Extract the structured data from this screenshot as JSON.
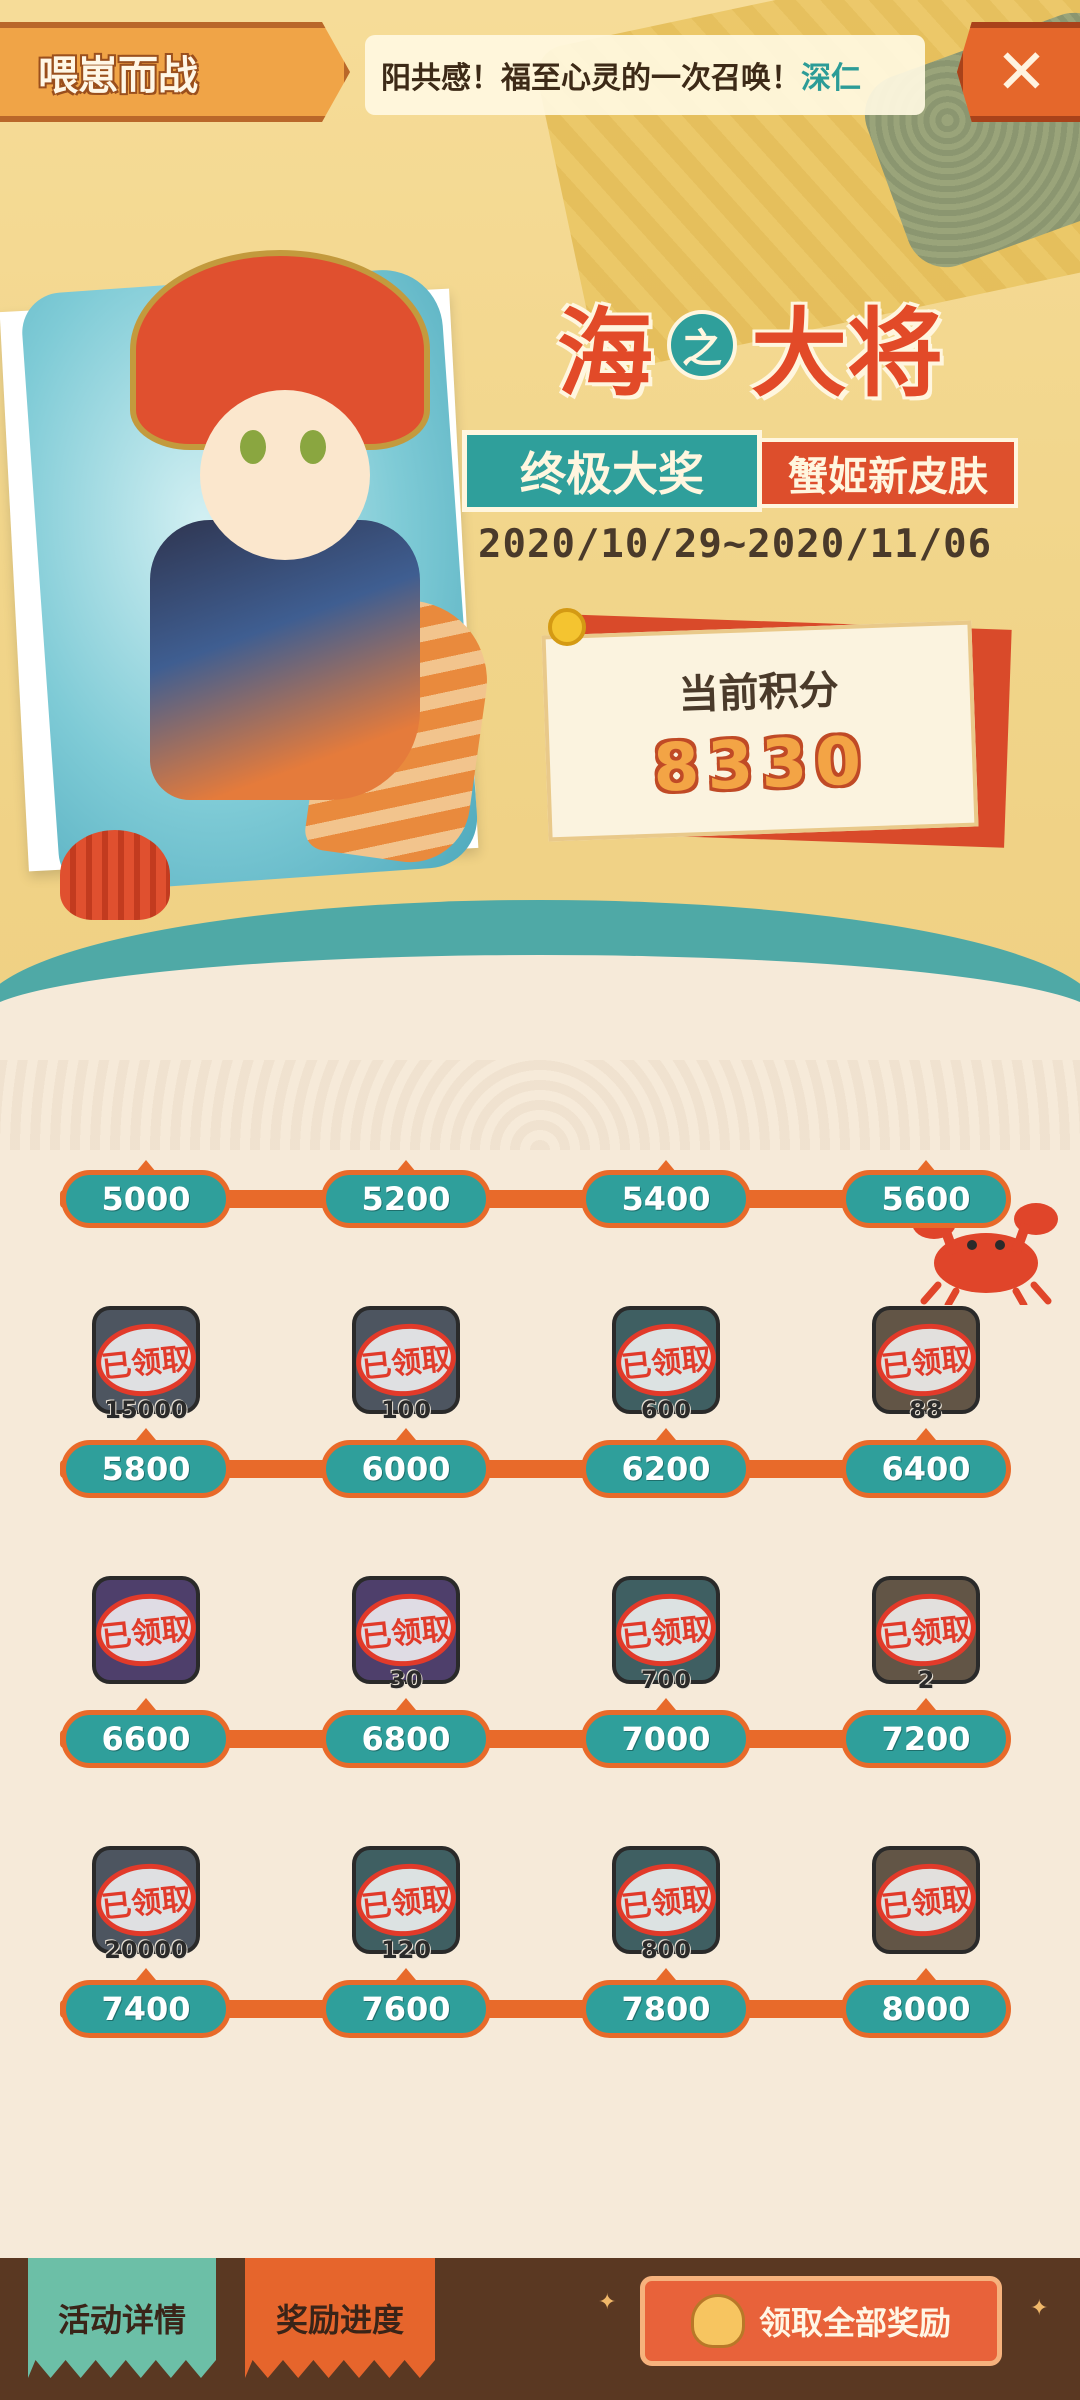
{
  "header": {
    "title": "喂崽而战",
    "marquee": "阳共感！福至心灵的一次召唤！",
    "marquee_tail": "深仁",
    "close_label": "✕"
  },
  "hero": {
    "logo_char1": "海",
    "logo_char2": "之",
    "logo_char3": "大将",
    "grand_prize": "终极大奖",
    "prize_name": "蟹姬新皮肤",
    "date_range": "2020/10/29~2020/11/06",
    "score_label": "当前积分",
    "score_value": "8330"
  },
  "rewards": {
    "claimed_label": "已领取",
    "rows": [
      {
        "items": [
          {
            "threshold": "5000",
            "qty": ""
          },
          {
            "threshold": "5200",
            "qty": ""
          },
          {
            "threshold": "5400",
            "qty": ""
          },
          {
            "threshold": "5600",
            "qty": ""
          }
        ]
      },
      {
        "items": [
          {
            "threshold": "5800",
            "qty": "15000",
            "color": "slate"
          },
          {
            "threshold": "6000",
            "qty": "100",
            "color": "slate"
          },
          {
            "threshold": "6200",
            "qty": "600",
            "color": "teal"
          },
          {
            "threshold": "6400",
            "qty": "88",
            "color": "brown"
          }
        ]
      },
      {
        "items": [
          {
            "threshold": "6600",
            "qty": "",
            "color": "purple"
          },
          {
            "threshold": "6800",
            "qty": "30",
            "color": "purple"
          },
          {
            "threshold": "7000",
            "qty": "700",
            "color": "teal"
          },
          {
            "threshold": "7200",
            "qty": "2",
            "color": "brown"
          }
        ]
      },
      {
        "items": [
          {
            "threshold": "7400",
            "qty": "20000",
            "color": "slate"
          },
          {
            "threshold": "7600",
            "qty": "120",
            "color": "teal"
          },
          {
            "threshold": "7800",
            "qty": "800",
            "color": "teal"
          },
          {
            "threshold": "8000",
            "qty": "",
            "color": "brown"
          }
        ]
      }
    ]
  },
  "footer": {
    "tab_details": "活动详情",
    "tab_progress": "奖励进度",
    "claim_all": "领取全部奖励"
  },
  "colors": {
    "accent_teal": "#2f9f9b",
    "accent_orange": "#e86a2a",
    "stamp_red": "#e13a2a"
  }
}
